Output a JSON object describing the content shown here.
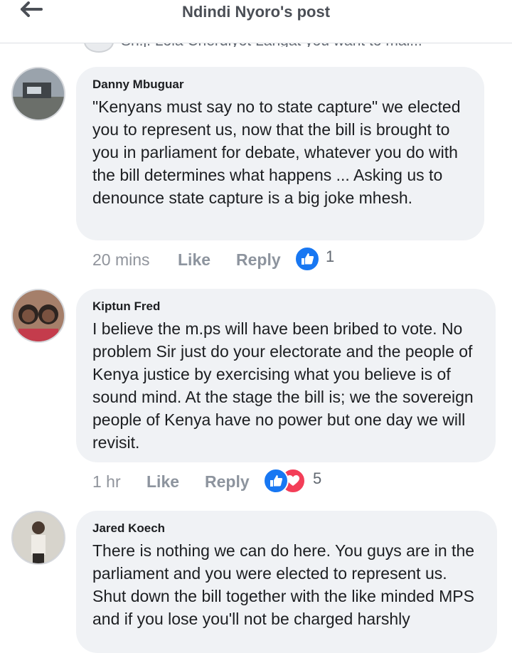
{
  "header": {
    "title": "Ndindi Nyoro's post",
    "back_icon": "arrow-left-icon"
  },
  "prev_comment": {
    "name": "",
    "text": "Sh.j. Lola Cherdiyot Langat you want to mai..."
  },
  "comments": [
    {
      "author": "Danny Mbuguar",
      "text": "\"Kenyans must say no to state capture\"   we elected you to represent us, now that the bill is brought to you in parliament for debate, whatever you do with the bill determines what happens ... Asking us to denounce state capture is a big joke mhesh.",
      "time": "20 mins",
      "like": "Like",
      "reply": "Reply",
      "reactions": [
        "like"
      ],
      "reaction_count": "1"
    },
    {
      "author": "Kiptun Fred",
      "text": "I believe the m.ps will have been bribed to vote. No problem Sir just do your electorate and the people of Kenya justice by exercising what you believe is of sound mind. At the stage the bill is; we the sovereign people of Kenya have no power but one day we will revisit.",
      "time": "1 hr",
      "like": "Like",
      "reply": "Reply",
      "reactions": [
        "like",
        "love"
      ],
      "reaction_count": "5"
    },
    {
      "author": "Jared Koech",
      "text": "There is nothing we can do here. You guys are in the parliament and you were elected to represent us. Shut down the bill together with the like minded MPS and if you lose you'll not be charged harshly",
      "time": "",
      "like": "",
      "reply": "",
      "reactions": [],
      "reaction_count": ""
    }
  ],
  "colors": {
    "bubble": "#f0f2f5",
    "like_blue": "#1877f2",
    "love_red": "#f33e58",
    "meta_gray": "#90949c"
  }
}
